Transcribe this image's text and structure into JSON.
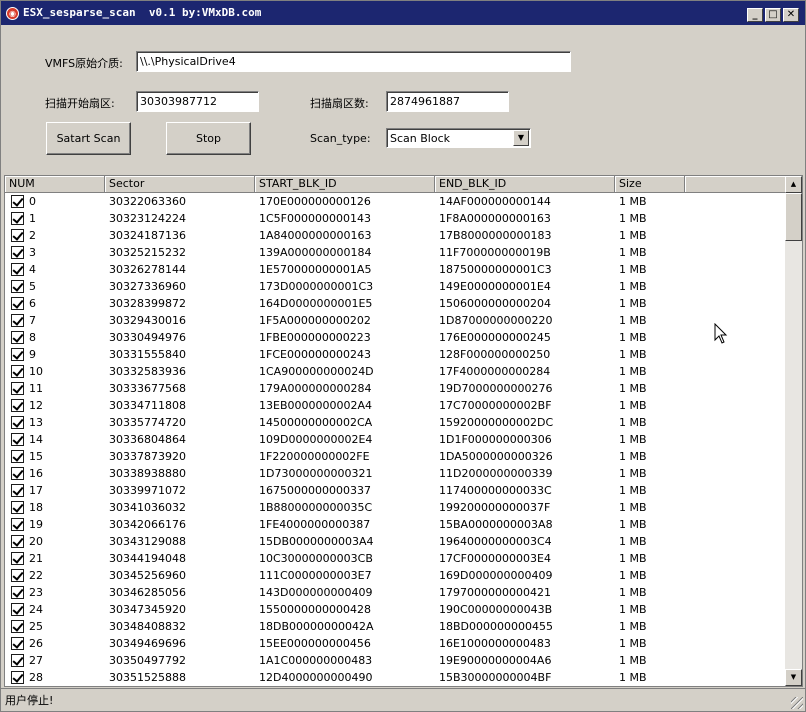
{
  "window": {
    "title": "ESX_sesparse_scan  v0.1 by:VMxDB.com",
    "controls": {
      "minimize": "_",
      "maximize": "□",
      "close": "✕"
    }
  },
  "form": {
    "media_label": "VMFS原始介质:",
    "media_value": "\\\\.\\PhysicalDrive4",
    "start_sector_label": "扫描开始扇区:",
    "start_sector_value": "30303987712",
    "sector_count_label": "扫描扇区数:",
    "sector_count_value": "2874961887",
    "start_button": "Satart Scan",
    "stop_button": "Stop",
    "scan_type_label": "Scan_type:",
    "scan_type_value": "Scan Block"
  },
  "table": {
    "columns": [
      "NUM",
      "Sector",
      "START_BLK_ID",
      "END_BLK_ID",
      "Size"
    ],
    "rows": [
      [
        "0",
        "30322063360",
        "170E000000000126",
        "14AF000000000144",
        "1 MB"
      ],
      [
        "1",
        "30323124224",
        "1C5F000000000143",
        "1F8A000000000163",
        "1 MB"
      ],
      [
        "2",
        "30324187136",
        "1A84000000000163",
        "17B8000000000183",
        "1 MB"
      ],
      [
        "3",
        "30325215232",
        "139A000000000184",
        "11F700000000019B",
        "1 MB"
      ],
      [
        "4",
        "30326278144",
        "1E570000000001A5",
        "18750000000001C3",
        "1 MB"
      ],
      [
        "5",
        "30327336960",
        "173D0000000001C3",
        "149E0000000001E4",
        "1 MB"
      ],
      [
        "6",
        "30328399872",
        "164D0000000001E5",
        "1506000000000204",
        "1 MB"
      ],
      [
        "7",
        "30329430016",
        "1F5A000000000202",
        "1D87000000000220",
        "1 MB"
      ],
      [
        "8",
        "30330494976",
        "1FBE000000000223",
        "176E000000000245",
        "1 MB"
      ],
      [
        "9",
        "30331555840",
        "1FCE000000000243",
        "128F000000000250",
        "1 MB"
      ],
      [
        "10",
        "30332583936",
        "1CA900000000024D",
        "17F4000000000284",
        "1 MB"
      ],
      [
        "11",
        "30333677568",
        "179A000000000284",
        "19D7000000000276",
        "1 MB"
      ],
      [
        "12",
        "30334711808",
        "13EB0000000002A4",
        "17C70000000002BF",
        "1 MB"
      ],
      [
        "13",
        "30335774720",
        "14500000000002CA",
        "15920000000002DC",
        "1 MB"
      ],
      [
        "14",
        "30336804864",
        "109D0000000002E4",
        "1D1F000000000306",
        "1 MB"
      ],
      [
        "15",
        "30337873920",
        "1F220000000002FE",
        "1DA5000000000326",
        "1 MB"
      ],
      [
        "16",
        "30338938880",
        "1D73000000000321",
        "11D2000000000339",
        "1 MB"
      ],
      [
        "17",
        "30339971072",
        "1675000000000337",
        "117400000000033C",
        "1 MB"
      ],
      [
        "18",
        "30341036032",
        "1B8800000000035C",
        "199200000000037F",
        "1 MB"
      ],
      [
        "19",
        "30342066176",
        "1FE4000000000387",
        "15BA0000000003A8",
        "1 MB"
      ],
      [
        "20",
        "30343129088",
        "15DB0000000003A4",
        "19640000000003C4",
        "1 MB"
      ],
      [
        "21",
        "30344194048",
        "10C30000000003CB",
        "17CF0000000003E4",
        "1 MB"
      ],
      [
        "22",
        "30345256960",
        "111C0000000003E7",
        "169D000000000409",
        "1 MB"
      ],
      [
        "23",
        "30346285056",
        "143D000000000409",
        "1797000000000421",
        "1 MB"
      ],
      [
        "24",
        "30347345920",
        "1550000000000428",
        "190C00000000043B",
        "1 MB"
      ],
      [
        "25",
        "30348408832",
        "18DB00000000042A",
        "18BD000000000455",
        "1 MB"
      ],
      [
        "26",
        "30349469696",
        "15EE000000000456",
        "16E1000000000483",
        "1 MB"
      ],
      [
        "27",
        "30350497792",
        "1A1C000000000483",
        "19E90000000004A6",
        "1 MB"
      ],
      [
        "28",
        "30351525888",
        "12D4000000000490",
        "15B30000000004BF",
        "1 MB"
      ]
    ]
  },
  "status": {
    "text": "用户停止!"
  },
  "icons": {
    "app": "app-icon",
    "check": "checkbox-checked-icon",
    "scroll_up": "▲",
    "scroll_down": "▼",
    "combo_arrow": "▼"
  }
}
